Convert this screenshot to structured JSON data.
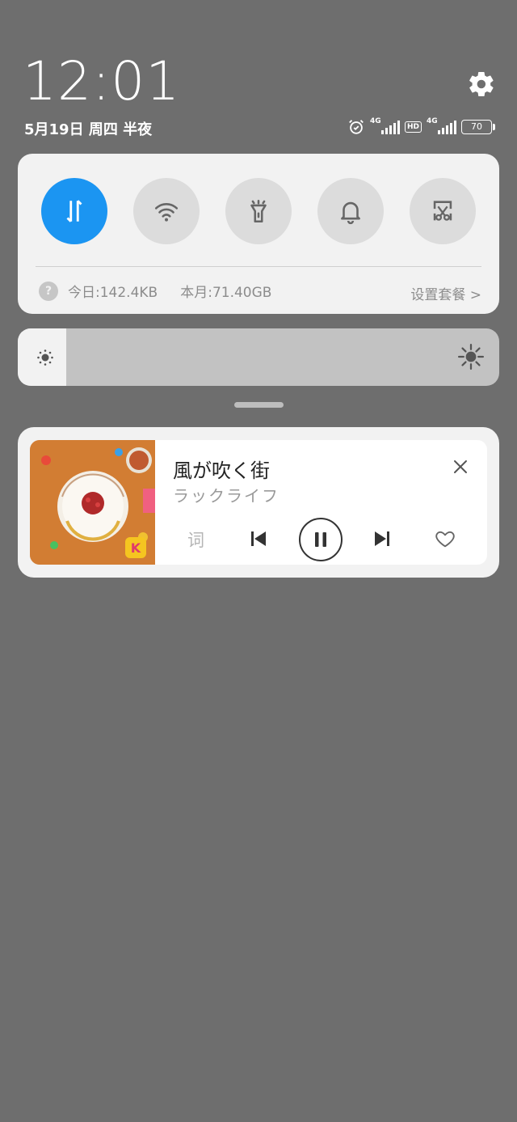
{
  "header": {
    "time": "12:01",
    "date": "5月19日 周四 半夜"
  },
  "status_bar": {
    "sim1_network": "4G",
    "hd_label": "HD",
    "sim2_network": "4G",
    "battery_level": "70"
  },
  "quick_toggles": [
    {
      "name": "mobile-data",
      "icon": "data-arrows-icon",
      "active": true
    },
    {
      "name": "wifi",
      "icon": "wifi-icon",
      "active": false
    },
    {
      "name": "flashlight",
      "icon": "flashlight-icon",
      "active": false
    },
    {
      "name": "notification-sound",
      "icon": "bell-icon",
      "active": false
    },
    {
      "name": "screenshot",
      "icon": "scissors-screenshot-icon",
      "active": false
    }
  ],
  "data_usage": {
    "today_label": "今日:142.4KB",
    "month_label": "本月:71.40GB",
    "plan_link": "设置套餐 >"
  },
  "brightness": {
    "level": 0.1
  },
  "media": {
    "song_title": "風が吹く街",
    "artist": "ラックライフ",
    "lyrics_label": "词",
    "state": "playing"
  },
  "colors": {
    "accent": "#1b95f2",
    "background": "#6e6e6e",
    "panel": "#f2f2f2"
  }
}
